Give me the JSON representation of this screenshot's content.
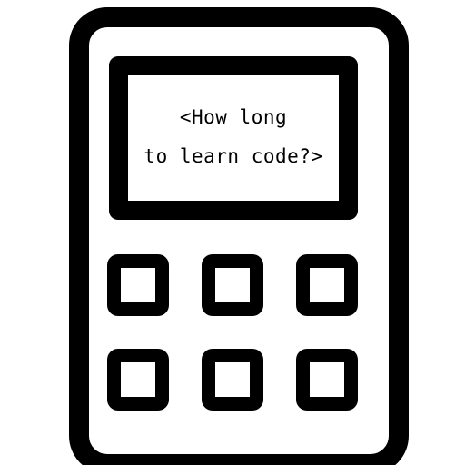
{
  "display": {
    "line1": "<How long",
    "line2": "to learn code?>"
  },
  "keypad": {
    "keys": [
      "",
      "",
      "",
      "",
      "",
      ""
    ]
  },
  "colors": {
    "outline": "#000000",
    "fill": "#ffffff"
  },
  "icon": "calculator-icon"
}
